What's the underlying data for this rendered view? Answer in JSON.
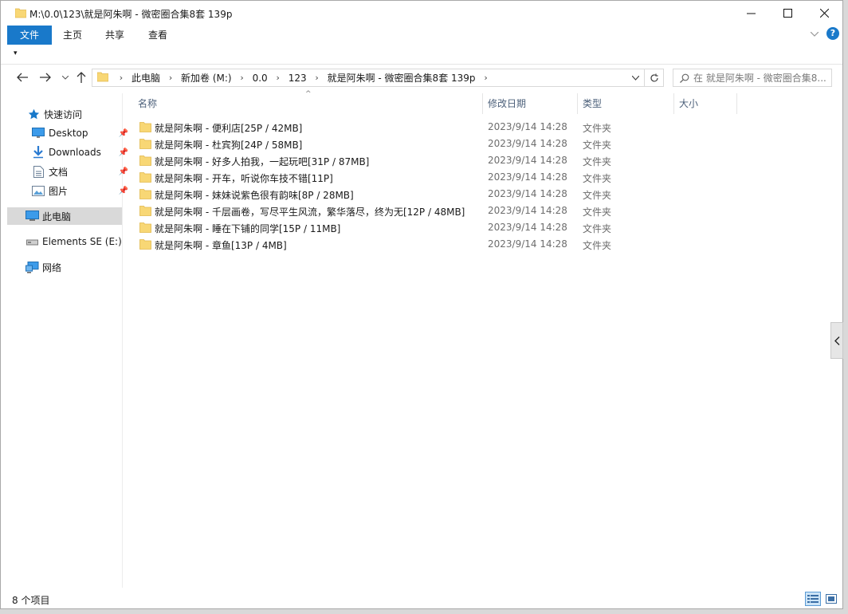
{
  "window": {
    "title": "M:\\0.0\\123\\就是阿朱啊 - 微密圈合集8套 139p"
  },
  "ribbon": {
    "tabs": [
      "文件",
      "主页",
      "共享",
      "查看"
    ],
    "help": "?"
  },
  "qat": {
    "glyph": "▾"
  },
  "address": {
    "crumbs": [
      "此电脑",
      "新加卷 (M:)",
      "0.0",
      "123",
      "就是阿朱啊 - 微密圈合集8套 139p"
    ]
  },
  "search": {
    "placeholder": "在 就是阿朱啊 - 微密圈合集8..."
  },
  "sidebar": {
    "quick_access": "快速访问",
    "items": [
      {
        "label": "Desktop",
        "icon": "desktop-icon",
        "pinned": true
      },
      {
        "label": "Downloads",
        "icon": "downloads-icon",
        "pinned": true
      },
      {
        "label": "文档",
        "icon": "documents-icon",
        "pinned": true
      },
      {
        "label": "图片",
        "icon": "pictures-icon",
        "pinned": true
      }
    ],
    "this_pc": "此电脑",
    "drive": "Elements SE (E:)",
    "network": "网络"
  },
  "columns": {
    "name": "名称",
    "date": "修改日期",
    "type": "类型",
    "size": "大小"
  },
  "files": [
    {
      "name": "就是阿朱啊 - 便利店[25P / 42MB]",
      "date": "2023/9/14 14:28",
      "type": "文件夹"
    },
    {
      "name": "就是阿朱啊 - 杜宾狗[24P / 58MB]",
      "date": "2023/9/14 14:28",
      "type": "文件夹"
    },
    {
      "name": "就是阿朱啊 - 好多人拍我，一起玩吧[31P / 87MB]",
      "date": "2023/9/14 14:28",
      "type": "文件夹"
    },
    {
      "name": "就是阿朱啊 - 开车，听说你车技不错[11P]",
      "date": "2023/9/14 14:28",
      "type": "文件夹"
    },
    {
      "name": "就是阿朱啊 - 妹妹说紫色很有韵味[8P / 28MB]",
      "date": "2023/9/14 14:28",
      "type": "文件夹"
    },
    {
      "name": "就是阿朱啊 - 千层画卷，写尽平生风流，繁华落尽，终为无[12P / 48MB]",
      "date": "2023/9/14 14:28",
      "type": "文件夹"
    },
    {
      "name": "就是阿朱啊 - 睡在下铺的同学[15P / 11MB]",
      "date": "2023/9/14 14:28",
      "type": "文件夹"
    },
    {
      "name": "就是阿朱啊 - 章鱼[13P / 4MB]",
      "date": "2023/9/14 14:28",
      "type": "文件夹"
    }
  ],
  "status": {
    "count": "8 个项目"
  },
  "colors": {
    "accent": "#1979ca",
    "folder": "#f8d775",
    "selected": "#d9d9d9",
    "header_text": "#4c607a"
  }
}
